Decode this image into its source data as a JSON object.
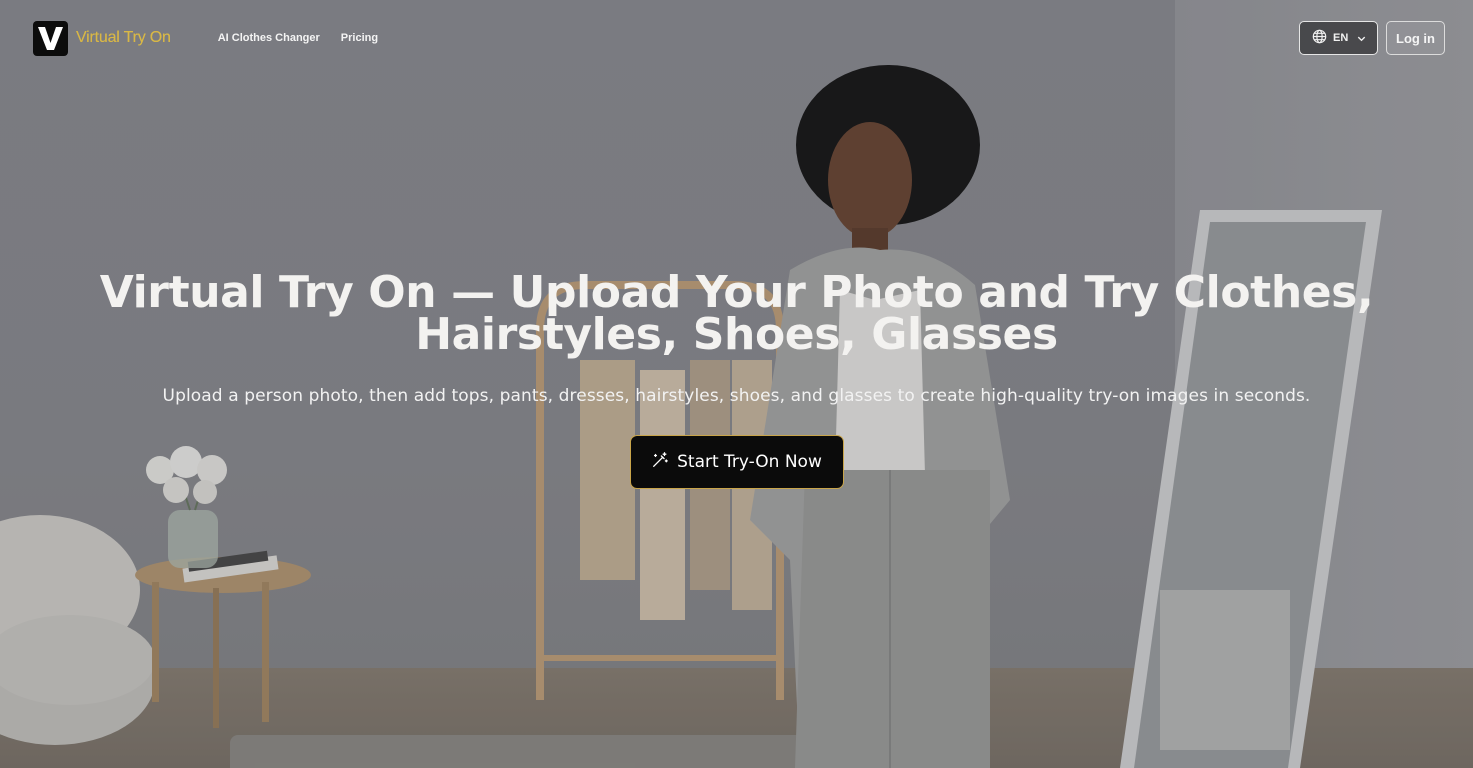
{
  "brand": {
    "name": "Virtual Try On",
    "mark": "V",
    "accent": "#d8b746"
  },
  "nav": {
    "items": [
      "AI Clothes Changer",
      "Pricing"
    ]
  },
  "language": {
    "selected": "EN",
    "icon": "globe-icon"
  },
  "auth": {
    "login_label": "Log in"
  },
  "hero": {
    "title": "Virtual Try On — Upload Your Photo and Try Clothes, Hairstyles, Shoes, Glasses",
    "subtitle": "Upload a person photo, then add tops, pants, dresses, hairstyles, shoes, and glasses to create high-quality try-on images in seconds.",
    "cta_label": "Start Try-On Now",
    "cta_icon": "magic-wand-icon"
  },
  "colors": {
    "cta_background": "#0b0b0b",
    "cta_border": "#c9a54a",
    "text": "#f3f2f0"
  }
}
